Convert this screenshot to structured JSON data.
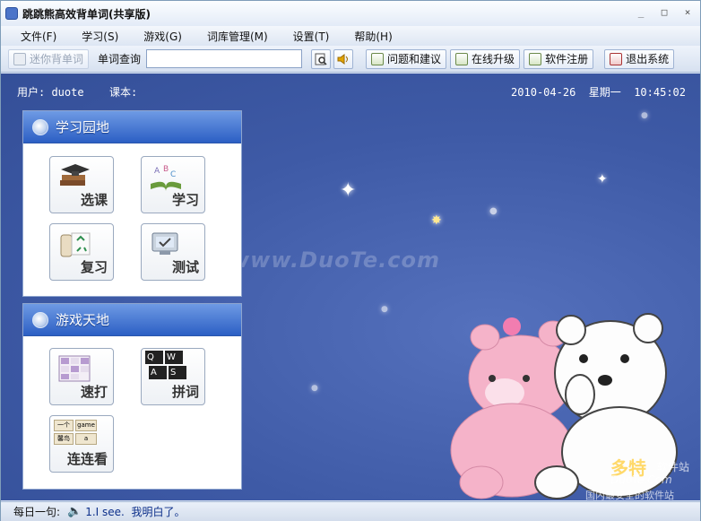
{
  "window": {
    "title": "跳跳熊高效背单词(共享版)",
    "controls": {
      "min": "_",
      "max": "□",
      "close": "×"
    }
  },
  "menu": [
    "文件(F)",
    "学习(S)",
    "游戏(G)",
    "词库管理(M)",
    "设置(T)",
    "帮助(H)"
  ],
  "toolbar": {
    "mini_label": "迷你背单词",
    "lookup_label": "单词查询",
    "lookup_value": "",
    "feedback_label": "问题和建议",
    "upgrade_label": "在线升级",
    "register_label": "软件注册",
    "exit_label": "退出系统"
  },
  "info": {
    "user": "用户: duote",
    "course": "课本:",
    "datetime": "2010-04-26  星期一  10:45:02"
  },
  "study_panel": {
    "title": "学习园地",
    "tiles": [
      {
        "label": "选课",
        "icon": "graduation-books-icon"
      },
      {
        "label": "学习",
        "icon": "abc-book-icon"
      },
      {
        "label": "复习",
        "icon": "recycle-scroll-icon"
      },
      {
        "label": "测试",
        "icon": "monitor-test-icon"
      }
    ]
  },
  "game_panel": {
    "title": "游戏天地",
    "tiles": [
      {
        "label": "速打",
        "icon": "typing-grid-icon"
      },
      {
        "label": "拼词",
        "icon": "keyboard-keys-icon",
        "keys": [
          "Q",
          "W",
          "A",
          "S"
        ]
      },
      {
        "label": "连连看",
        "icon": "match-cards-icon",
        "cards": [
          "一个",
          "game",
          "馨鸟",
          "a"
        ]
      }
    ]
  },
  "watermark": "www.DuoTe.com",
  "corner_logo": {
    "line1": "多特",
    "line2": "软件站",
    "line3": "DuoTe.Com",
    "line4": "国内最安全的软件站"
  },
  "status": {
    "label": "每日一句:",
    "sentence": "1.I see.  我明白了。"
  },
  "colors": {
    "background": "#3e5aa6",
    "panel_header": "#2c5fc4",
    "status_text": "#0c2f8a"
  }
}
